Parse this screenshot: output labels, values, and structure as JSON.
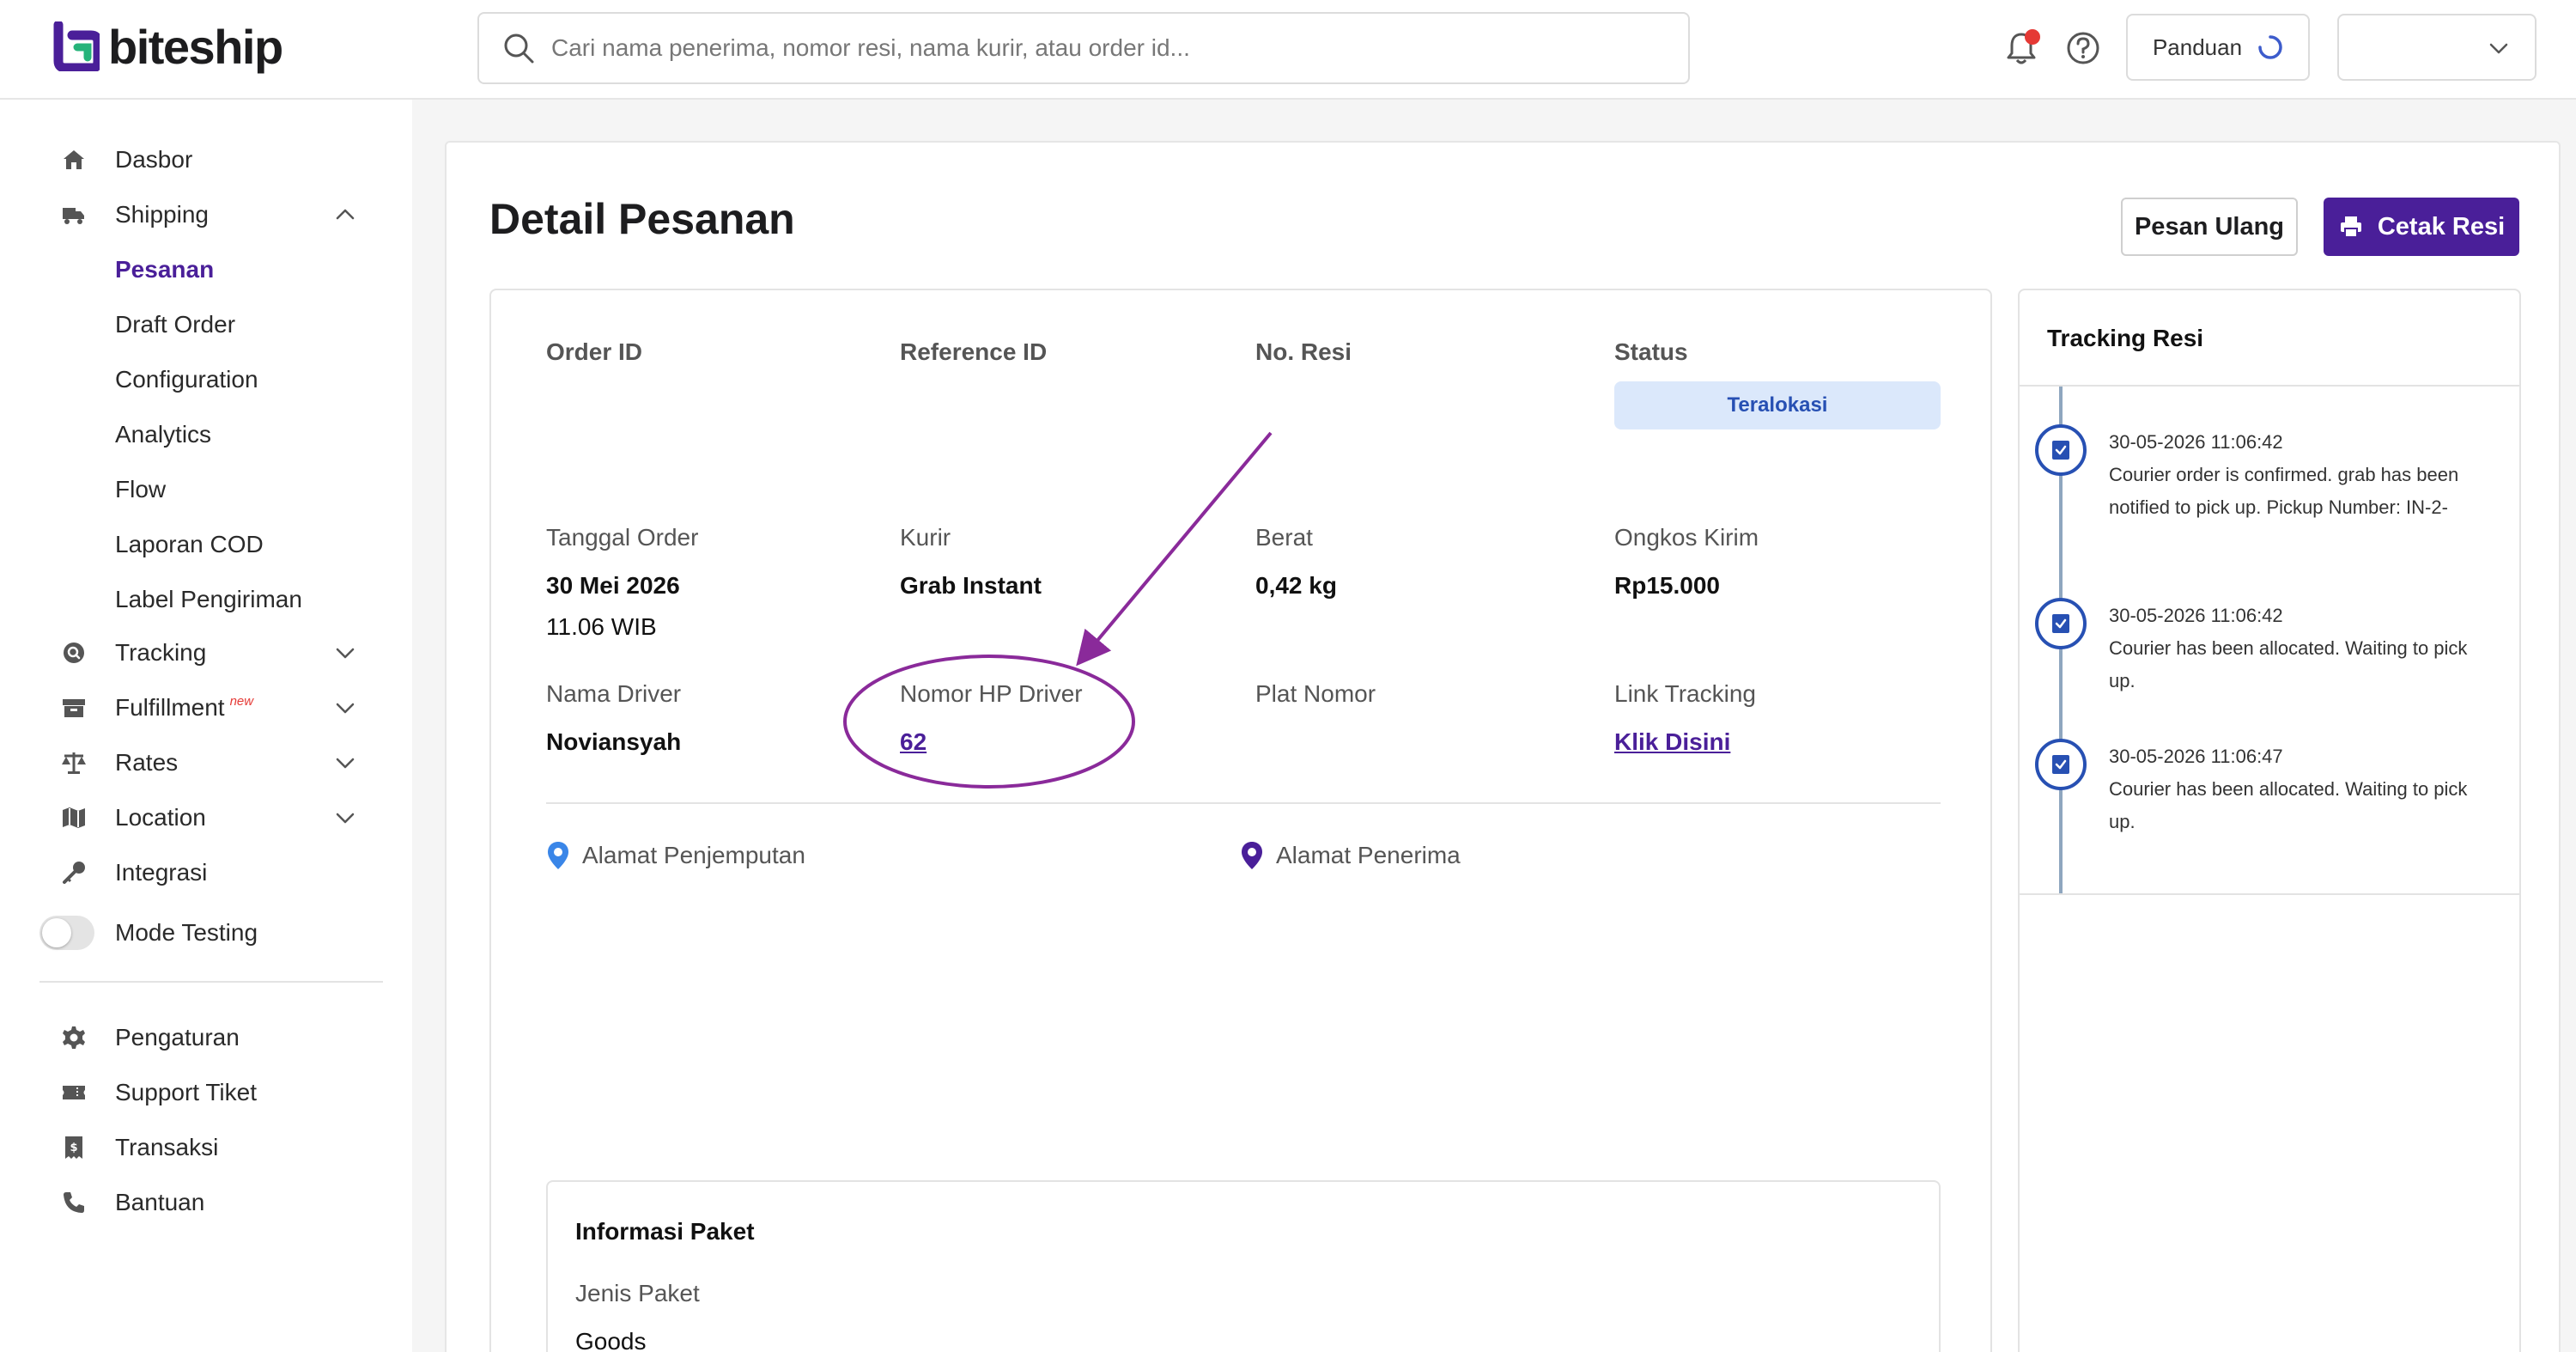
{
  "brand": {
    "name": "biteship",
    "accent": "#4a1f99",
    "mark_green": "#26b37a"
  },
  "search": {
    "placeholder": "Cari nama penerima, nomor resi, nama kurir, atau order id..."
  },
  "header": {
    "guide_label": "Panduan"
  },
  "sidebar": {
    "items": [
      {
        "label": "Dasbor",
        "icon": "home-icon"
      },
      {
        "label": "Shipping",
        "icon": "shipping-icon",
        "expanded": true
      },
      {
        "label": "Tracking",
        "icon": "tracking-icon"
      },
      {
        "label": "Fulfillment",
        "icon": "box-icon",
        "badge": "new"
      },
      {
        "label": "Rates",
        "icon": "scale-icon"
      },
      {
        "label": "Location",
        "icon": "map-icon"
      },
      {
        "label": "Integrasi",
        "icon": "key-icon"
      }
    ],
    "shipping_sub": [
      "Pesanan",
      "Draft Order",
      "Configuration",
      "Analytics",
      "Flow",
      "Laporan COD",
      "Label Pengiriman"
    ],
    "active_sub": "Pesanan",
    "mode_testing": {
      "label": "Mode Testing",
      "on": false
    },
    "bottom": [
      {
        "label": "Pengaturan",
        "icon": "gear-icon"
      },
      {
        "label": "Support Tiket",
        "icon": "ticket-icon"
      },
      {
        "label": "Transaksi",
        "icon": "receipt-icon"
      },
      {
        "label": "Bantuan",
        "icon": "phone-icon"
      }
    ]
  },
  "page": {
    "title": "Detail Pesanan",
    "reorder_label": "Pesan Ulang",
    "print_label": "Cetak Resi"
  },
  "order": {
    "order_id_label": "Order ID",
    "reference_id_label": "Reference ID",
    "resi_label": "No. Resi",
    "status_label": "Status",
    "status_value": "Teralokasi",
    "order_date_label": "Tanggal Order",
    "order_date_value": "30 Mei 2026",
    "order_time_value": "11.06 WIB",
    "courier_label": "Kurir",
    "courier_value": "Grab Instant",
    "weight_label": "Berat",
    "weight_value": "0,42 kg",
    "shipping_cost_label": "Ongkos Kirim",
    "shipping_cost_value": "Rp15.000",
    "driver_name_label": "Nama Driver",
    "driver_name_value": "Noviansyah",
    "driver_phone_label": "Nomor HP Driver",
    "driver_phone_value": "62",
    "plate_label": "Plat Nomor",
    "tracking_link_label": "Link Tracking",
    "tracking_link_value": "Klik Disini",
    "pickup_address_label": "Alamat Penjemputan",
    "receiver_address_label": "Alamat Penerima"
  },
  "package": {
    "title": "Informasi Paket",
    "type_label": "Jenis Paket",
    "type_value": "Goods"
  },
  "tracking": {
    "title": "Tracking Resi",
    "events": [
      {
        "time": "30-05-2026 11:06:42",
        "desc": "Courier order is confirmed. grab has been notified to pick up. Pickup Number: IN-2-"
      },
      {
        "time": "30-05-2026 11:06:42",
        "desc": "Courier has been allocated. Waiting to pick up."
      },
      {
        "time": "30-05-2026 11:06:47",
        "desc": "Courier has been allocated. Waiting to pick up."
      }
    ]
  },
  "colors": {
    "status_bg": "#dbe8fb",
    "status_text": "#2750b3",
    "annotation": "#8a2a9a",
    "notification_dot": "#e53935"
  }
}
